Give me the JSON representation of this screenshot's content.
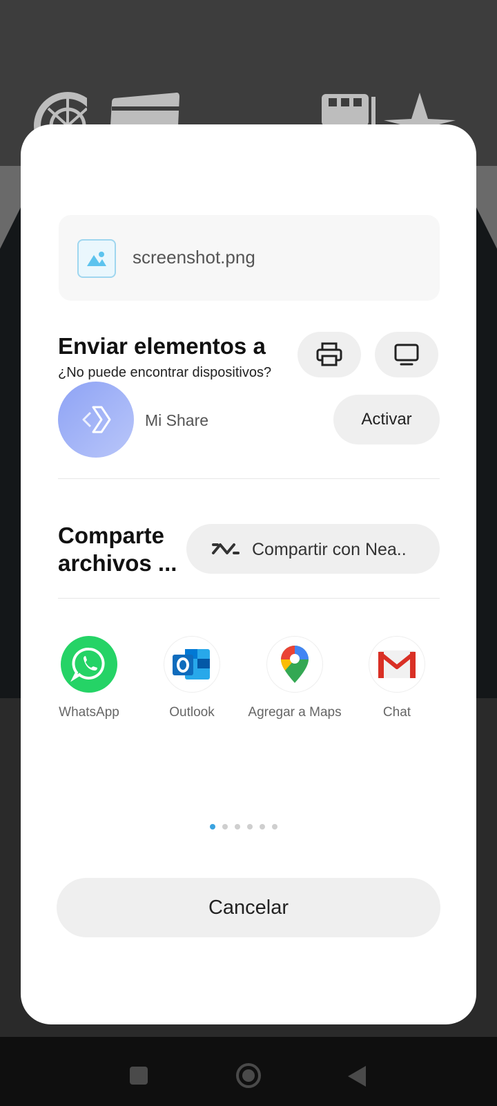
{
  "file": {
    "name": "screenshot.png",
    "icon": "image-icon"
  },
  "send": {
    "title": "Enviar elementos a",
    "subtitle": "¿No puede encontrar dispositivos?",
    "print_icon": "printer-icon",
    "cast_icon": "monitor-icon",
    "mishare_label": "Mi Share",
    "activate_label": "Activar"
  },
  "share": {
    "title": "Comparte archivos ...",
    "nearby_label": "Compartir con Nea.."
  },
  "apps": [
    {
      "label": "WhatsApp",
      "icon": "whatsapp-icon"
    },
    {
      "label": "Outlook",
      "icon": "outlook-icon"
    },
    {
      "label": "Agregar a Maps",
      "icon": "google-maps-icon"
    },
    {
      "label": "Chat",
      "icon": "gmail-icon"
    }
  ],
  "pager": {
    "count": 6,
    "active": 1
  },
  "cancel_label": "Cancelar",
  "colors": {
    "accent": "#3aa3e0",
    "whatsapp": "#25d366",
    "outlook": "#0f6cbd",
    "gmail": "#d93025",
    "mishare": "#9aabf6"
  }
}
